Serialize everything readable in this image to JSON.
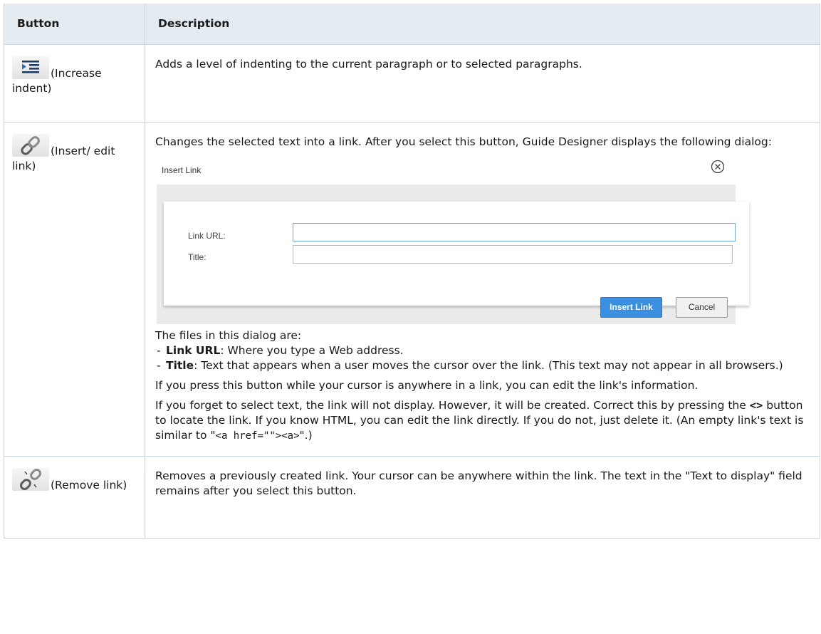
{
  "header": {
    "col_button": "Button",
    "col_description": "Description"
  },
  "rows": [
    {
      "icon": "increase-indent-icon",
      "label": "(Increase indent)",
      "description": "Adds a level of indenting to the current paragraph or to selected paragraphs."
    },
    {
      "icon": "link-icon",
      "label": "(Insert/ edit link)",
      "intro": "Changes the selected text into a link. After you select this button, Guide Designer displays the following dialog:",
      "dialog": {
        "title": "Insert Link",
        "link_url_label": "Link URL:",
        "link_url_value": "",
        "title_label": "Title:",
        "title_value": "",
        "insert_button": "Insert Link",
        "cancel_button": "Cancel",
        "primary_color": "#3b8fe0"
      },
      "files_intro": "The files in this dialog are:",
      "files": [
        {
          "term": "Link URL",
          "text": ": Where you type a Web address."
        },
        {
          "term": "Title",
          "text": ": Text that appears when a user moves the cursor over the link. (This text may not appear in all browsers.)"
        }
      ],
      "edit_note": "If you press this button while your cursor is anywhere in a link, you can edit the link's information.",
      "forget_note_1": "If you forget to select text, the link will not display. However, it will be created. Correct this by pressing the ",
      "forget_note_kbd": "<>",
      "forget_note_2": " button to locate the link. If you know HTML, you can edit the link directly. If you do not, just delete it. (An empty link's text is similar to \"",
      "forget_note_code": "<a href=\"\"><a>",
      "forget_note_3": "\".)"
    },
    {
      "icon": "unlink-icon",
      "label": "(Remove link)",
      "description": "Removes a previously created link. Your cursor can be anywhere within the link. The text in the \"Text to display\" field remains after you select this button."
    }
  ]
}
